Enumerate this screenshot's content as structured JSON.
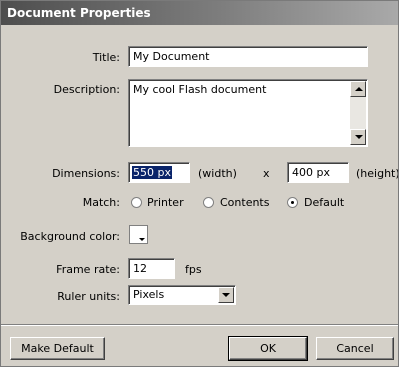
{
  "window": {
    "title": "Document Properties"
  },
  "fields": {
    "title": {
      "label": "Title:",
      "value": "My Document"
    },
    "description": {
      "label": "Description:",
      "value": "My cool Flash document"
    },
    "dimensions": {
      "label": "Dimensions:",
      "width_value": "550 px",
      "width_unit": "(width)",
      "separator": "x",
      "height_value": "400 px",
      "height_unit": "(height)"
    },
    "match": {
      "label": "Match:",
      "options": [
        "Printer",
        "Contents",
        "Default"
      ],
      "selected": "Default"
    },
    "background_color": {
      "label": "Background color:",
      "color": "#ffffff"
    },
    "frame_rate": {
      "label": "Frame rate:",
      "value": "12",
      "unit": "fps"
    },
    "ruler_units": {
      "label": "Ruler units:",
      "value": "Pixels"
    }
  },
  "buttons": {
    "make_default": "Make Default",
    "ok": "OK",
    "cancel": "Cancel"
  }
}
